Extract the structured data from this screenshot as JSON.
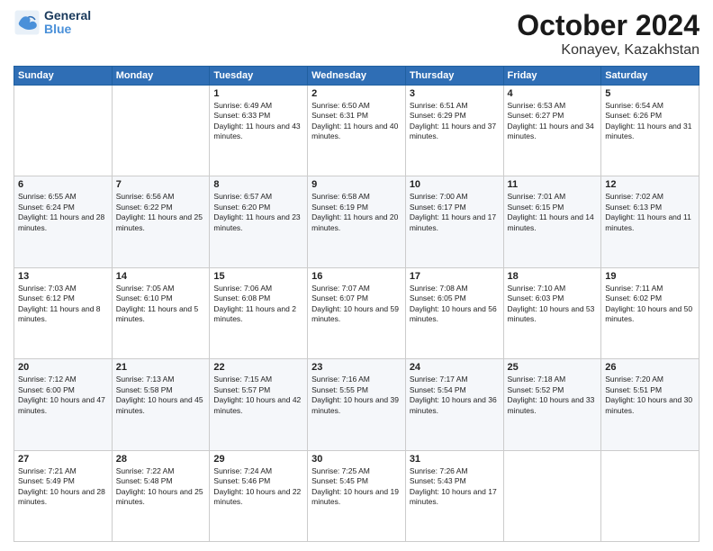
{
  "logo": {
    "line1": "General",
    "line2": "Blue"
  },
  "title": "October 2024",
  "subtitle": "Konayev, Kazakhstan",
  "headers": [
    "Sunday",
    "Monday",
    "Tuesday",
    "Wednesday",
    "Thursday",
    "Friday",
    "Saturday"
  ],
  "weeks": [
    [
      {
        "day": "",
        "sunrise": "",
        "sunset": "",
        "daylight": ""
      },
      {
        "day": "",
        "sunrise": "",
        "sunset": "",
        "daylight": ""
      },
      {
        "day": "1",
        "sunrise": "Sunrise: 6:49 AM",
        "sunset": "Sunset: 6:33 PM",
        "daylight": "Daylight: 11 hours and 43 minutes."
      },
      {
        "day": "2",
        "sunrise": "Sunrise: 6:50 AM",
        "sunset": "Sunset: 6:31 PM",
        "daylight": "Daylight: 11 hours and 40 minutes."
      },
      {
        "day": "3",
        "sunrise": "Sunrise: 6:51 AM",
        "sunset": "Sunset: 6:29 PM",
        "daylight": "Daylight: 11 hours and 37 minutes."
      },
      {
        "day": "4",
        "sunrise": "Sunrise: 6:53 AM",
        "sunset": "Sunset: 6:27 PM",
        "daylight": "Daylight: 11 hours and 34 minutes."
      },
      {
        "day": "5",
        "sunrise": "Sunrise: 6:54 AM",
        "sunset": "Sunset: 6:26 PM",
        "daylight": "Daylight: 11 hours and 31 minutes."
      }
    ],
    [
      {
        "day": "6",
        "sunrise": "Sunrise: 6:55 AM",
        "sunset": "Sunset: 6:24 PM",
        "daylight": "Daylight: 11 hours and 28 minutes."
      },
      {
        "day": "7",
        "sunrise": "Sunrise: 6:56 AM",
        "sunset": "Sunset: 6:22 PM",
        "daylight": "Daylight: 11 hours and 25 minutes."
      },
      {
        "day": "8",
        "sunrise": "Sunrise: 6:57 AM",
        "sunset": "Sunset: 6:20 PM",
        "daylight": "Daylight: 11 hours and 23 minutes."
      },
      {
        "day": "9",
        "sunrise": "Sunrise: 6:58 AM",
        "sunset": "Sunset: 6:19 PM",
        "daylight": "Daylight: 11 hours and 20 minutes."
      },
      {
        "day": "10",
        "sunrise": "Sunrise: 7:00 AM",
        "sunset": "Sunset: 6:17 PM",
        "daylight": "Daylight: 11 hours and 17 minutes."
      },
      {
        "day": "11",
        "sunrise": "Sunrise: 7:01 AM",
        "sunset": "Sunset: 6:15 PM",
        "daylight": "Daylight: 11 hours and 14 minutes."
      },
      {
        "day": "12",
        "sunrise": "Sunrise: 7:02 AM",
        "sunset": "Sunset: 6:13 PM",
        "daylight": "Daylight: 11 hours and 11 minutes."
      }
    ],
    [
      {
        "day": "13",
        "sunrise": "Sunrise: 7:03 AM",
        "sunset": "Sunset: 6:12 PM",
        "daylight": "Daylight: 11 hours and 8 minutes."
      },
      {
        "day": "14",
        "sunrise": "Sunrise: 7:05 AM",
        "sunset": "Sunset: 6:10 PM",
        "daylight": "Daylight: 11 hours and 5 minutes."
      },
      {
        "day": "15",
        "sunrise": "Sunrise: 7:06 AM",
        "sunset": "Sunset: 6:08 PM",
        "daylight": "Daylight: 11 hours and 2 minutes."
      },
      {
        "day": "16",
        "sunrise": "Sunrise: 7:07 AM",
        "sunset": "Sunset: 6:07 PM",
        "daylight": "Daylight: 10 hours and 59 minutes."
      },
      {
        "day": "17",
        "sunrise": "Sunrise: 7:08 AM",
        "sunset": "Sunset: 6:05 PM",
        "daylight": "Daylight: 10 hours and 56 minutes."
      },
      {
        "day": "18",
        "sunrise": "Sunrise: 7:10 AM",
        "sunset": "Sunset: 6:03 PM",
        "daylight": "Daylight: 10 hours and 53 minutes."
      },
      {
        "day": "19",
        "sunrise": "Sunrise: 7:11 AM",
        "sunset": "Sunset: 6:02 PM",
        "daylight": "Daylight: 10 hours and 50 minutes."
      }
    ],
    [
      {
        "day": "20",
        "sunrise": "Sunrise: 7:12 AM",
        "sunset": "Sunset: 6:00 PM",
        "daylight": "Daylight: 10 hours and 47 minutes."
      },
      {
        "day": "21",
        "sunrise": "Sunrise: 7:13 AM",
        "sunset": "Sunset: 5:58 PM",
        "daylight": "Daylight: 10 hours and 45 minutes."
      },
      {
        "day": "22",
        "sunrise": "Sunrise: 7:15 AM",
        "sunset": "Sunset: 5:57 PM",
        "daylight": "Daylight: 10 hours and 42 minutes."
      },
      {
        "day": "23",
        "sunrise": "Sunrise: 7:16 AM",
        "sunset": "Sunset: 5:55 PM",
        "daylight": "Daylight: 10 hours and 39 minutes."
      },
      {
        "day": "24",
        "sunrise": "Sunrise: 7:17 AM",
        "sunset": "Sunset: 5:54 PM",
        "daylight": "Daylight: 10 hours and 36 minutes."
      },
      {
        "day": "25",
        "sunrise": "Sunrise: 7:18 AM",
        "sunset": "Sunset: 5:52 PM",
        "daylight": "Daylight: 10 hours and 33 minutes."
      },
      {
        "day": "26",
        "sunrise": "Sunrise: 7:20 AM",
        "sunset": "Sunset: 5:51 PM",
        "daylight": "Daylight: 10 hours and 30 minutes."
      }
    ],
    [
      {
        "day": "27",
        "sunrise": "Sunrise: 7:21 AM",
        "sunset": "Sunset: 5:49 PM",
        "daylight": "Daylight: 10 hours and 28 minutes."
      },
      {
        "day": "28",
        "sunrise": "Sunrise: 7:22 AM",
        "sunset": "Sunset: 5:48 PM",
        "daylight": "Daylight: 10 hours and 25 minutes."
      },
      {
        "day": "29",
        "sunrise": "Sunrise: 7:24 AM",
        "sunset": "Sunset: 5:46 PM",
        "daylight": "Daylight: 10 hours and 22 minutes."
      },
      {
        "day": "30",
        "sunrise": "Sunrise: 7:25 AM",
        "sunset": "Sunset: 5:45 PM",
        "daylight": "Daylight: 10 hours and 19 minutes."
      },
      {
        "day": "31",
        "sunrise": "Sunrise: 7:26 AM",
        "sunset": "Sunset: 5:43 PM",
        "daylight": "Daylight: 10 hours and 17 minutes."
      },
      {
        "day": "",
        "sunrise": "",
        "sunset": "",
        "daylight": ""
      },
      {
        "day": "",
        "sunrise": "",
        "sunset": "",
        "daylight": ""
      }
    ]
  ]
}
